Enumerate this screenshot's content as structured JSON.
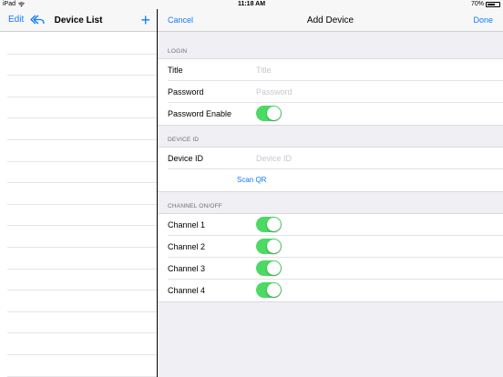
{
  "status_bar": {
    "device": "iPad",
    "time": "11:18 AM",
    "battery": "70%",
    "battery_level": 0.7
  },
  "left_pane": {
    "edit_label": "Edit",
    "title": "Device List",
    "add_label": "+",
    "rows": [
      "",
      "",
      "",
      "",
      "",
      "",
      "",
      "",
      "",
      "",
      "",
      "",
      "",
      "",
      "",
      ""
    ]
  },
  "right_pane": {
    "cancel_label": "Cancel",
    "title": "Add Device",
    "done_label": "Done",
    "login": {
      "header": "LOGIN",
      "title_label": "Title",
      "title_placeholder": "Title",
      "password_label": "Password",
      "password_placeholder": "Password",
      "password_enable_label": "Password Enable",
      "password_enable_on": true
    },
    "device_id": {
      "header": "DEVICE ID",
      "device_id_label": "Device ID",
      "device_id_placeholder": "Device ID",
      "scan_qr_label": "Scan QR"
    },
    "channels": {
      "header": "CHANNEL ON/OFF",
      "items": [
        {
          "label": "Channel 1",
          "on": true
        },
        {
          "label": "Channel 2",
          "on": true
        },
        {
          "label": "Channel 3",
          "on": true
        },
        {
          "label": "Channel 4",
          "on": true
        }
      ]
    }
  },
  "colors": {
    "accent": "#0f7bff",
    "toggle_on": "#4cd964",
    "grouped_bg": "#efeff4"
  }
}
